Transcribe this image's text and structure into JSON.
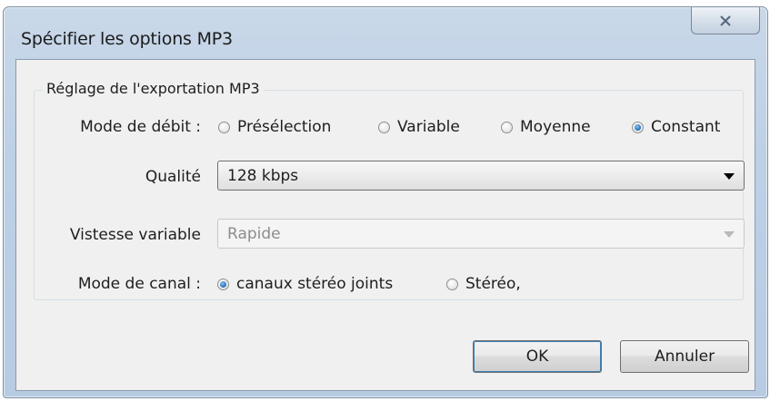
{
  "window": {
    "title": "Spécifier les options MP3"
  },
  "titlebar": {
    "close_icon": "close-icon"
  },
  "group": {
    "title": "Réglage de l'exportation MP3"
  },
  "bitrate_mode": {
    "label": "Mode de débit :",
    "options": [
      {
        "label": "Présélection",
        "checked": false
      },
      {
        "label": "Variable",
        "checked": false
      },
      {
        "label": "Moyenne",
        "checked": false
      },
      {
        "label": "Constant",
        "checked": true
      }
    ]
  },
  "quality": {
    "label": "Qualité",
    "value": "128 kbps"
  },
  "variable_speed": {
    "label": "Vistesse variable",
    "value": "Rapide",
    "disabled": true
  },
  "channel_mode": {
    "label": "Mode de canal :",
    "options": [
      {
        "label": "canaux stéréo joints",
        "checked": true
      },
      {
        "label": "Stéréo,",
        "checked": false
      }
    ]
  },
  "buttons": {
    "ok": "OK",
    "cancel": "Annuler"
  }
}
